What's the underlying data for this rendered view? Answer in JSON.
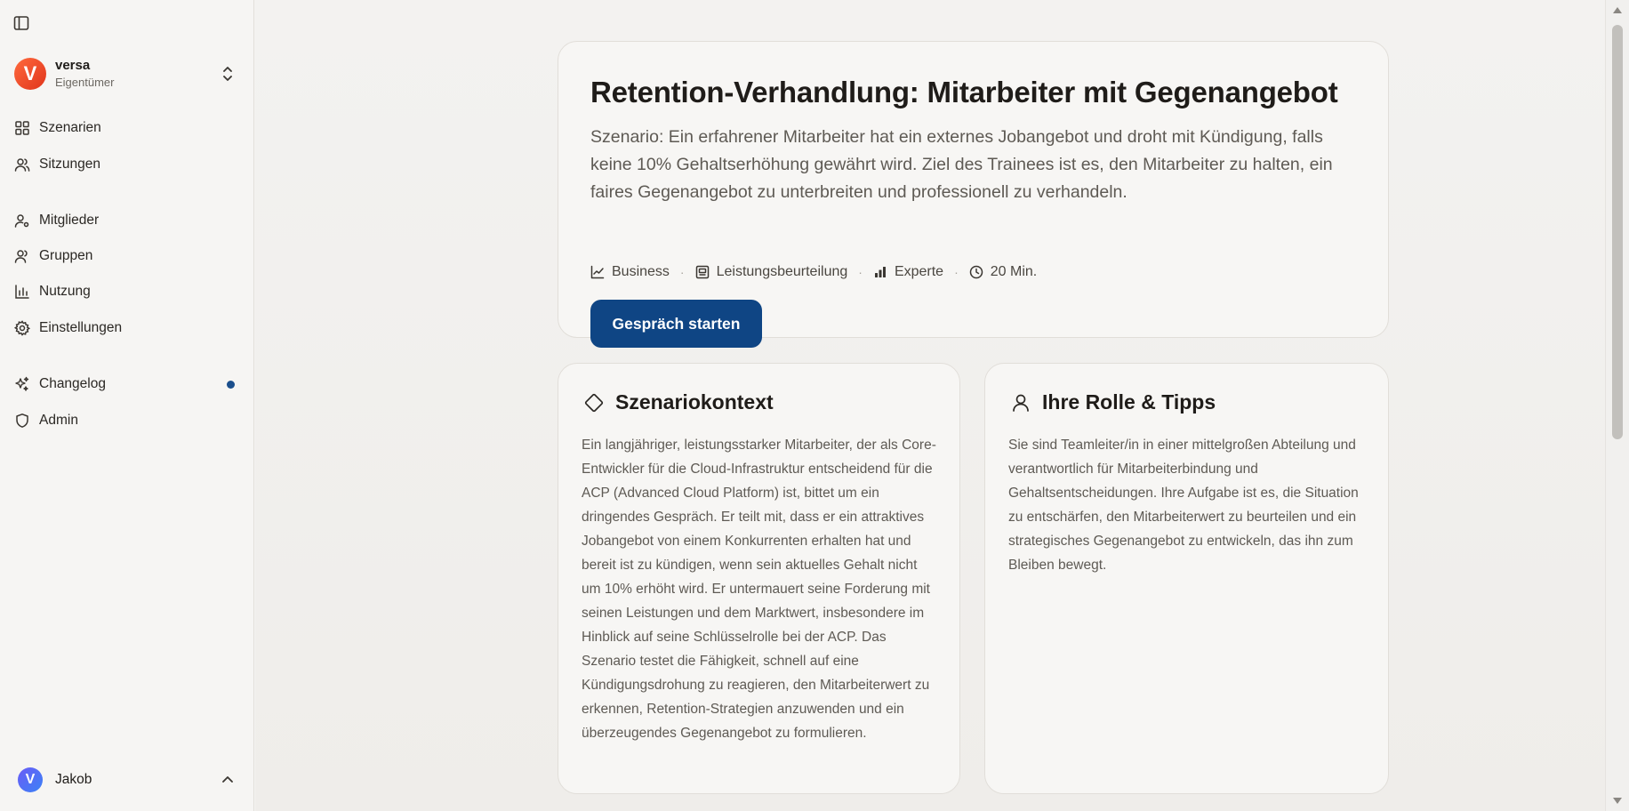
{
  "sidebar": {
    "org": {
      "logo_letter": "V",
      "name": "versa",
      "role": "Eigentümer"
    },
    "items": [
      {
        "label": "Szenarien",
        "icon": "grid-icon"
      },
      {
        "label": "Sitzungen",
        "icon": "users-icon"
      },
      {
        "label": "Mitglieder",
        "icon": "user-cog-icon"
      },
      {
        "label": "Gruppen",
        "icon": "group-icon"
      },
      {
        "label": "Nutzung",
        "icon": "bar-chart-icon"
      },
      {
        "label": "Einstellungen",
        "icon": "gear-icon"
      },
      {
        "label": "Changelog",
        "icon": "sparkles-icon"
      },
      {
        "label": "Admin",
        "icon": "shield-icon"
      }
    ],
    "changelog_dot_color": "#1b4f8c",
    "user": {
      "avatar_letter": "V",
      "name": "Jakob"
    }
  },
  "hero": {
    "title": "Retention-Verhandlung: Mitarbeiter mit Gegenangebot",
    "description": "Szenario: Ein erfahrener Mitarbeiter hat ein externes Jobangebot und droht mit Kündigung, falls keine 10% Gehaltserhöhung gewährt wird. Ziel des Trainees ist es, den Mitarbeiter zu halten, ein faires Gegenangebot zu unterbreiten und professionell zu verhandeln.",
    "meta": {
      "category": "Business",
      "topic": "Leistungsbeurteilung",
      "level": "Experte",
      "duration": "20 Min."
    },
    "start_button": "Gespräch starten"
  },
  "context_card": {
    "title": "Szenariokontext",
    "body": "Ein langjähriger, leistungsstarker Mitarbeiter, der als Core-Entwickler für die Cloud-Infrastruktur entscheidend für die ACP (Advanced Cloud Platform) ist, bittet um ein dringendes Gespräch. Er teilt mit, dass er ein attraktives Jobangebot von einem Konkurrenten erhalten hat und bereit ist zu kündigen, wenn sein aktuelles Gehalt nicht um 10% erhöht wird. Er untermauert seine Forderung mit seinen Leistungen und dem Marktwert, insbesondere im Hinblick auf seine Schlüsselrolle bei der ACP. Das Szenario testet die Fähigkeit, schnell auf eine Kündigungsdrohung zu reagieren, den Mitarbeiterwert zu erkennen, Retention-Strategien anzuwenden und ein überzeugendes Gegenangebot zu formulieren."
  },
  "tips_card": {
    "title": "Ihre Rolle & Tipps",
    "body": "Sie sind Teamleiter/in in einer mittelgroßen Abteilung und verantwortlich für Mitarbeiterbindung und Gehaltsentscheidungen. Ihre Aufgabe ist es, die Situation zu entschärfen, den Mitarbeiterwert zu beurteilen und ein strategisches Gegenangebot zu entwickeln, das ihn zum Bleiben bewegt."
  },
  "colors": {
    "primary_button": "#0f4584",
    "org_logo": "#e8452a"
  }
}
